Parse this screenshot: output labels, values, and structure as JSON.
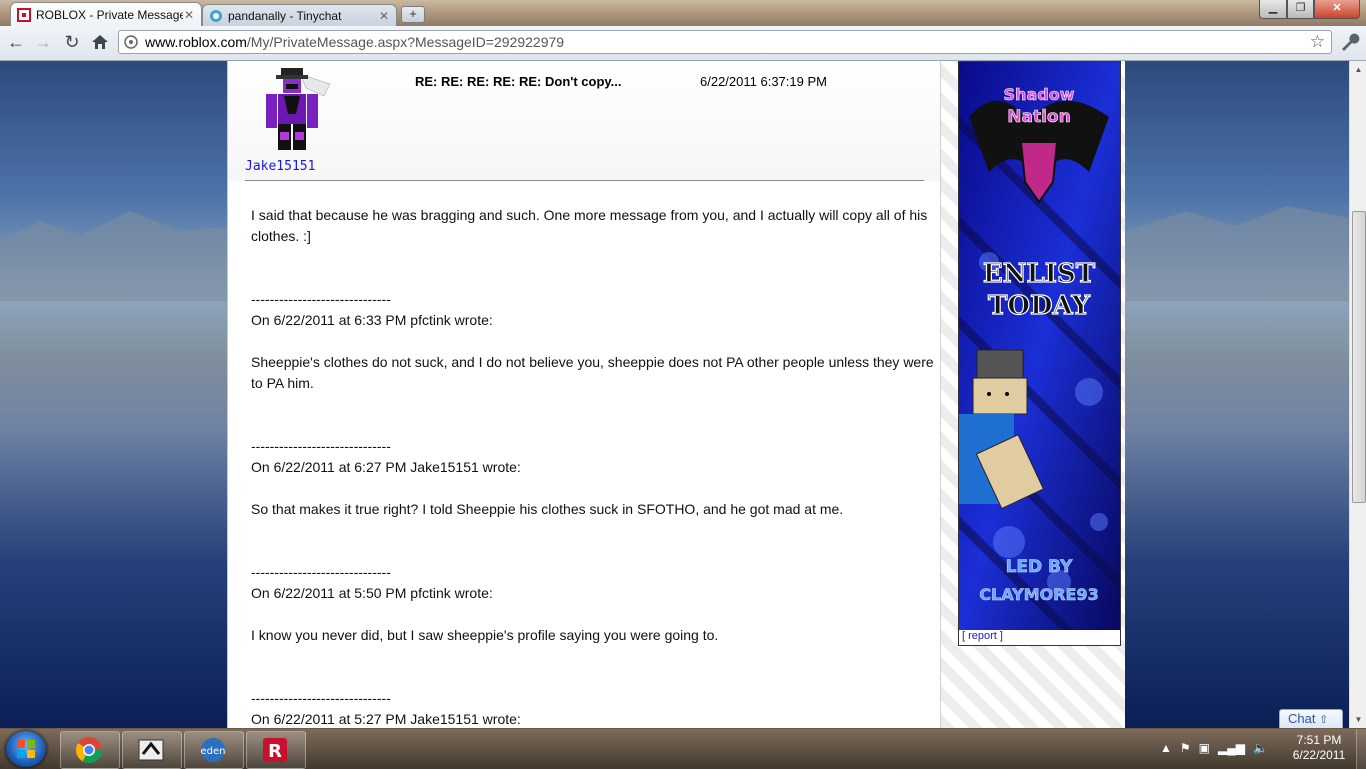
{
  "browser": {
    "tabs": [
      {
        "title": "ROBLOX - Private Message",
        "active": true
      },
      {
        "title": "pandanally - Tinychat",
        "active": false
      }
    ],
    "url_host": "www.roblox.com",
    "url_path": "/My/PrivateMessage.aspx?MessageID=292922979"
  },
  "message": {
    "sender": "Jake15151",
    "subject": "RE: RE: RE: RE: RE: Don't copy...",
    "sent": "6/22/2011 6:37:19 PM",
    "body": [
      {
        "text": "I said that because he was bragging and such. One more message from you, and I actually will copy all of his clothes. :]"
      },
      {
        "text": "------------------------------"
      },
      {
        "text": "On 6/22/2011 at 6:33 PM pfctink wrote:"
      },
      {
        "text": "Sheeppie's clothes do not suck, and I do not believe you, sheeppie does not PA other people unless they were to PA him."
      },
      {
        "text": "------------------------------"
      },
      {
        "text": "On 6/22/2011 at 6:27 PM Jake15151 wrote:"
      },
      {
        "text": "So that makes it true right? I told Sheeppie his clothes suck in SFOTHO, and he got mad at me."
      },
      {
        "text": "------------------------------"
      },
      {
        "text": "On 6/22/2011 at 5:50 PM pfctink wrote:"
      },
      {
        "text": "I know you never did, but I saw sheeppie's profile saying you were going to."
      },
      {
        "text": "------------------------------"
      },
      {
        "text": "On 6/22/2011 at 5:27 PM Jake15151 wrote:"
      }
    ]
  },
  "ad": {
    "line1": "Shadow",
    "line2": "Nation",
    "line3": "ENLIST",
    "line4": "TODAY",
    "line5": "LED BY",
    "line6": "CLAYMORE93",
    "report": "[ report ]"
  },
  "chat_label": "Chat",
  "taskbar": {
    "time": "7:51 PM",
    "date": "6/22/2011"
  }
}
